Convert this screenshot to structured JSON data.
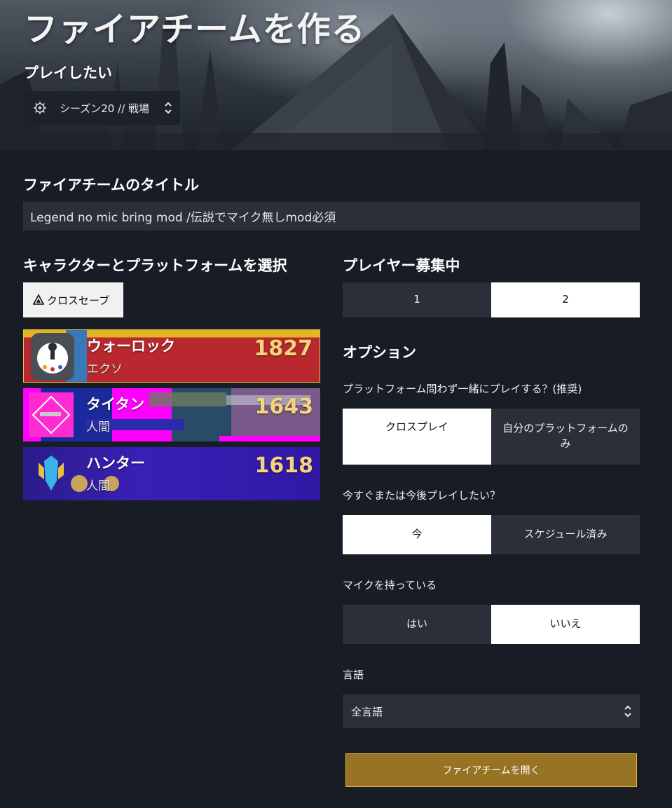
{
  "header": {
    "title": "ファイアチームを作る",
    "play_label": "プレイしたい",
    "activity": {
      "icon": "activity-gear-icon",
      "label": "シーズン20 // 戦場"
    }
  },
  "fireteam_title": {
    "heading": "ファイアチームのタイトル",
    "value": "Legend no mic bring mod /伝説でマイク無しmod必須"
  },
  "characters": {
    "heading": "キャラクターとプラットフォームを選択",
    "cross_save_label": "クロスセーブ",
    "items": [
      {
        "class": "ウォーロック",
        "race": "エクソ",
        "power": "1827",
        "selected": true
      },
      {
        "class": "タイタン",
        "race": "人間",
        "power": "1643",
        "selected": false
      },
      {
        "class": "ハンター",
        "race": "人間",
        "power": "1618",
        "selected": false
      }
    ]
  },
  "players": {
    "heading": "プレイヤー募集中",
    "options": [
      "1",
      "2"
    ],
    "selected": "2"
  },
  "options": {
    "heading": "オプション",
    "crossplay": {
      "question": "プラットフォーム問わず一緒にプレイする？(推奨)",
      "options": [
        "クロスプレイ",
        "自分のプラットフォームのみ"
      ],
      "selected": "クロスプレイ"
    },
    "timing": {
      "question": "今すぐまたは今後プレイしたい？",
      "options": [
        "今",
        "スケジュール済み"
      ],
      "selected": "今"
    },
    "mic": {
      "question": "マイクを持っている",
      "options": [
        "はい",
        "いいえ"
      ],
      "selected": "いいえ"
    },
    "language": {
      "label": "言語",
      "value": "全言語"
    }
  },
  "submit_label": "ファイアチームを開く",
  "colors": {
    "background": "#181c25",
    "panel": "#2b2f3a",
    "accent_gold": "#977323",
    "power_gold": "#f6d57a"
  }
}
